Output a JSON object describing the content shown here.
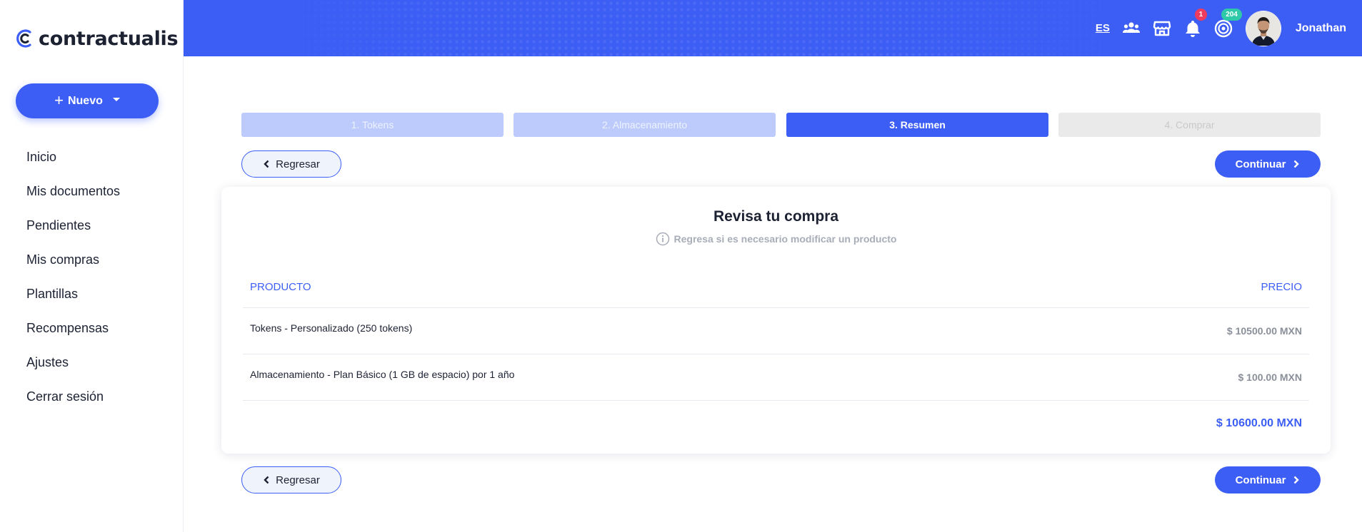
{
  "brand": {
    "name": "contractualis"
  },
  "sidebar": {
    "new_button": "Nuevo",
    "items": [
      {
        "label": "Inicio"
      },
      {
        "label": "Mis documentos"
      },
      {
        "label": "Pendientes"
      },
      {
        "label": "Mis compras"
      },
      {
        "label": "Plantillas"
      },
      {
        "label": "Recompensas"
      },
      {
        "label": "Ajustes"
      },
      {
        "label": "Cerrar sesión"
      }
    ]
  },
  "header": {
    "language": "ES",
    "icons": [
      "users-icon",
      "store-icon",
      "bell-icon",
      "coin-icon"
    ],
    "notifications_count": "1",
    "tokens_count": "204",
    "username": "Jonathan",
    "accent": "#3d5ef5"
  },
  "steps": [
    {
      "label": "1. Tokens",
      "state": "done"
    },
    {
      "label": "2. Almacenamiento",
      "state": "done"
    },
    {
      "label": "3. Resumen",
      "state": "active"
    },
    {
      "label": "4. Comprar",
      "state": "todo"
    }
  ],
  "actions": {
    "back": "Regresar",
    "next": "Continuar"
  },
  "summary": {
    "title": "Revisa tu compra",
    "subtitle": "Regresa si es necesario modificar un producto",
    "col_product": "PRODUCTO",
    "col_price": "PRECIO",
    "rows": [
      {
        "product": "Tokens - Personalizado (250 tokens)",
        "price": "$ 10500.00 MXN"
      },
      {
        "product": "Almacenamiento - Plan Básico (1 GB de espacio) por 1 año",
        "price": "$ 100.00 MXN"
      }
    ],
    "total": "$ 10600.00 MXN"
  }
}
